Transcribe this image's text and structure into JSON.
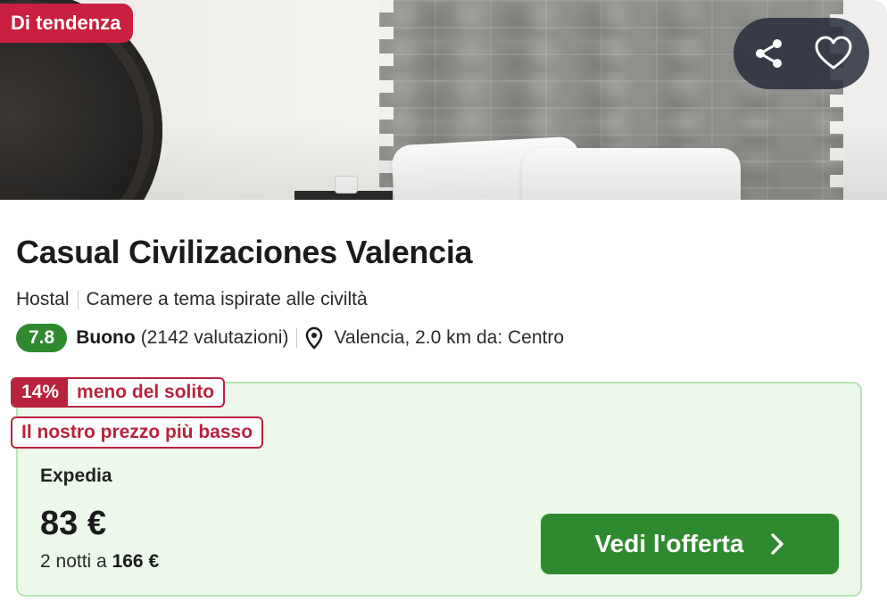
{
  "hero": {
    "badge": "Di tendenza",
    "actions": {
      "share_icon": "share-icon",
      "favorite_icon": "heart-icon"
    }
  },
  "hotel": {
    "name": "Casual Civilizaciones Valencia",
    "type": "Hostal",
    "theme": "Camere a tema ispirate alle civiltà",
    "score": "7.8",
    "rating_label": "Buono",
    "reviews": "(2142 valutazioni)",
    "location": "Valencia, 2.0 km da: Centro"
  },
  "offer": {
    "discount_pct": "14%",
    "discount_text": "meno del solito",
    "lowest_text": "Il nostro prezzo più basso",
    "provider": "Expedia",
    "price": "83 €",
    "nights_prefix": "2 notti a",
    "nights_total": "166 €",
    "cta_label": "Vedi l'offerta"
  },
  "colors": {
    "accent_green": "#2f8a2f",
    "deal_red": "#b8233e",
    "trend_red": "#c9203f",
    "offer_bg": "#ebf8ea"
  }
}
